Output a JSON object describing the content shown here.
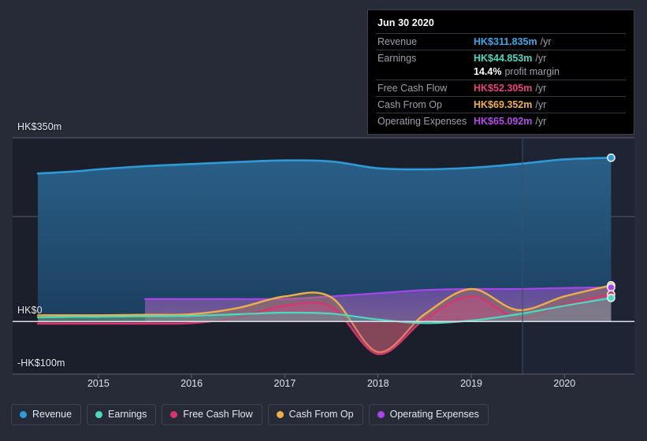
{
  "tooltip": {
    "title": "Jun 30 2020",
    "rows": [
      {
        "label": "Revenue",
        "value": "HK$311.835m",
        "unit": "/yr",
        "color": "#3aa8e8"
      },
      {
        "label": "Earnings",
        "value": "HK$44.853m",
        "unit": "/yr",
        "color": "#4bd9c0"
      },
      {
        "label": "Free Cash Flow",
        "value": "HK$52.305m",
        "unit": "/yr",
        "color": "#e8417f"
      },
      {
        "label": "Cash From Op",
        "value": "HK$69.352m",
        "unit": "/yr",
        "color": "#f0b04a"
      },
      {
        "label": "Operating Expenses",
        "value": "HK$65.092m",
        "unit": "/yr",
        "color": "#b44ae8"
      }
    ],
    "margin_value": "14.4%",
    "margin_label": "profit margin"
  },
  "legend": {
    "items": [
      {
        "label": "Revenue",
        "color": "#2e9bd6"
      },
      {
        "label": "Earnings",
        "color": "#4bd9c0"
      },
      {
        "label": "Free Cash Flow",
        "color": "#d6356e"
      },
      {
        "label": "Cash From Op",
        "color": "#efae4b"
      },
      {
        "label": "Operating Expenses",
        "color": "#a945e8"
      }
    ]
  },
  "axes": {
    "y_ticks": [
      {
        "label": "HK$350m",
        "value": 350
      },
      {
        "label": "HK$0",
        "value": 0
      },
      {
        "label": "-HK$100m",
        "value": -100
      }
    ],
    "x_ticks": [
      "2015",
      "2016",
      "2017",
      "2018",
      "2019",
      "2020"
    ]
  },
  "chart_data": {
    "type": "area",
    "title": "",
    "xlabel": "",
    "ylabel": "",
    "ylim": [
      -100,
      350
    ],
    "xlim": [
      2014.35,
      2020.75
    ],
    "grid": true,
    "legend_position": "bottom",
    "gridlines_y": [
      350,
      200,
      0,
      -100
    ],
    "currency": "HKD",
    "units": "millions",
    "forecast_boundary_x": 2019.55,
    "x": [
      2014.35,
      2014.75,
      2015.0,
      2015.5,
      2016.0,
      2016.5,
      2017.0,
      2017.5,
      2018.0,
      2018.5,
      2019.0,
      2019.5,
      2020.0,
      2020.5
    ],
    "series": [
      {
        "name": "Revenue",
        "color": "#2e9bd6",
        "fill": "#1d4463",
        "values": [
          282,
          286,
          290,
          296,
          300,
          304,
          307,
          305,
          292,
          290,
          293,
          300,
          309,
          312
        ]
      },
      {
        "name": "Earnings",
        "color": "#4bd9c0",
        "fill": "#2f6d73",
        "values": [
          8,
          9,
          9,
          10,
          11,
          14,
          17,
          15,
          4,
          -3,
          2,
          14,
          30,
          45
        ]
      },
      {
        "name": "Free Cash Flow",
        "color": "#d6356e",
        "fill": "#8c3a63",
        "values": [
          -4,
          -4,
          -4,
          -4,
          -3,
          8,
          30,
          28,
          -62,
          4,
          48,
          7,
          32,
          52
        ]
      },
      {
        "name": "Cash From Op",
        "color": "#efae4b",
        "fill": "#7a5a46",
        "values": [
          12,
          12,
          12,
          13,
          14,
          26,
          48,
          46,
          -58,
          14,
          62,
          22,
          48,
          69
        ]
      },
      {
        "name": "Operating Expenses",
        "color": "#a945e8",
        "fill": "#5a3a86",
        "values": [
          null,
          null,
          null,
          43,
          43,
          43,
          43,
          48,
          54,
          60,
          62,
          62,
          64,
          65
        ]
      }
    ]
  }
}
